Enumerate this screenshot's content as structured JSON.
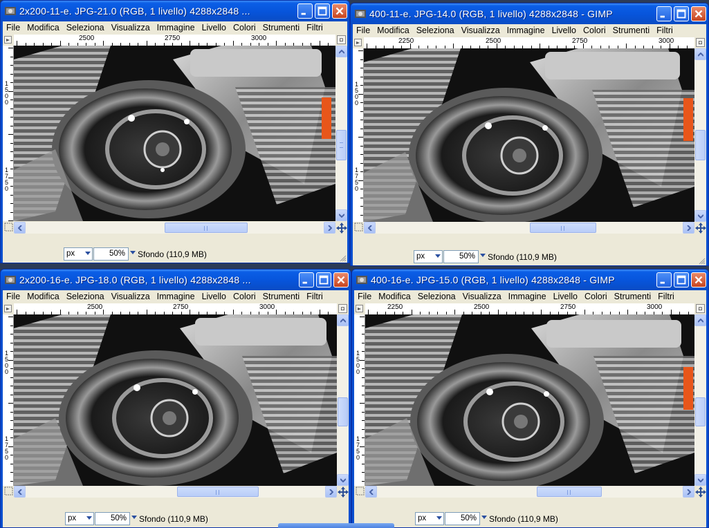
{
  "colors": {
    "titlebar": "#0a4fd0",
    "client": "#ece9d8",
    "scroll_arrow": "#4a64a8",
    "highlight": "#e8561a"
  },
  "windows": [
    {
      "title": "2x200-11-e. JPG-21.0 (RGB, 1 livello) 4288x2848 ...",
      "menu": [
        "File",
        "Modifica",
        "Seleziona",
        "Visualizza",
        "Immagine",
        "Livello",
        "Colori",
        "Strumenti",
        "Filtri"
      ],
      "hruler_labels": [
        "2500",
        "2750",
        "3000"
      ],
      "vruler_labels": [
        "1500",
        "1750"
      ],
      "unit": "px",
      "zoom": "50%",
      "layer_info": "Sfondo (110,9 MB)",
      "window_buttons": {
        "minimize": "minimize-icon",
        "maximize": "maximize-icon",
        "close": "close-icon"
      }
    },
    {
      "title": "400-11-e. JPG-14.0 (RGB, 1 livello) 4288x2848 - GIMP",
      "menu": [
        "File",
        "Modifica",
        "Seleziona",
        "Visualizza",
        "Immagine",
        "Livello",
        "Colori",
        "Strumenti",
        "Filtri"
      ],
      "hruler_labels": [
        "2250",
        "2500",
        "2750",
        "3000"
      ],
      "vruler_labels": [
        "1500",
        "1750"
      ],
      "unit": "px",
      "zoom": "50%",
      "layer_info": "Sfondo (110,9 MB)",
      "window_buttons": {
        "minimize": "minimize-icon",
        "maximize": "maximize-icon",
        "close": "close-icon"
      }
    },
    {
      "title": "2x200-16-e. JPG-18.0 (RGB, 1 livello) 4288x2848 ...",
      "menu": [
        "File",
        "Modifica",
        "Seleziona",
        "Visualizza",
        "Immagine",
        "Livello",
        "Colori",
        "Strumenti",
        "Filtri"
      ],
      "hruler_labels": [
        "2500",
        "2750",
        "3000"
      ],
      "vruler_labels": [
        "1500",
        "1750"
      ],
      "unit": "px",
      "zoom": "50%",
      "layer_info": "Sfondo (110,9 MB)",
      "window_buttons": {
        "minimize": "minimize-icon",
        "maximize": "maximize-icon",
        "close": "close-icon"
      }
    },
    {
      "title": "400-16-e. JPG-15.0 (RGB, 1 livello) 4288x2848 - GIMP",
      "menu": [
        "File",
        "Modifica",
        "Seleziona",
        "Visualizza",
        "Immagine",
        "Livello",
        "Colori",
        "Strumenti",
        "Filtri"
      ],
      "hruler_labels": [
        "2250",
        "2500",
        "2750",
        "3000"
      ],
      "vruler_labels": [
        "1500",
        "1750"
      ],
      "unit": "px",
      "zoom": "50%",
      "layer_info": "Sfondo (110,9 MB)",
      "window_buttons": {
        "minimize": "minimize-icon",
        "maximize": "maximize-icon",
        "close": "close-icon"
      }
    }
  ]
}
